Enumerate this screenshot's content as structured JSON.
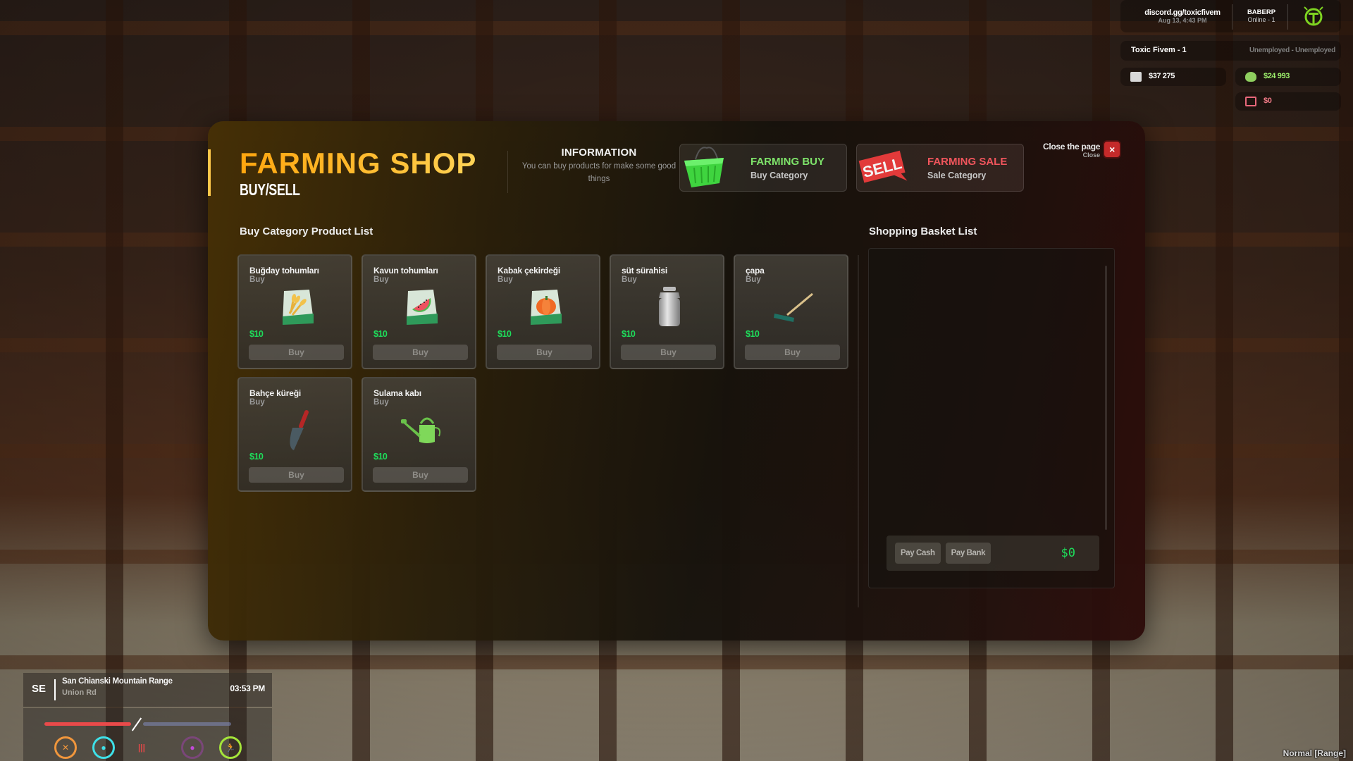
{
  "shop": {
    "title": "FARMING SHOP",
    "subtitle": "BUY/SELL",
    "info": {
      "title": "INFORMATION",
      "text": "You can buy products for make some good things"
    },
    "categories": [
      {
        "title": "FARMING BUY",
        "subtitle": "Buy Category",
        "icon": "basket-icon",
        "color": "#7ee36a"
      },
      {
        "title": "FARMING SALE",
        "subtitle": "Sale Category",
        "icon": "sell-tag-icon",
        "color": "#f0555c"
      }
    ],
    "close": {
      "title": "Close the page",
      "subtitle": "Close",
      "icon": "×"
    },
    "product_list_title": "Buy Category Product List",
    "basket_title": "Shopping Basket List",
    "products": [
      {
        "name": "Buğday tohumları",
        "action": "Buy",
        "price": "$10",
        "button": "Buy",
        "icon": "wheat-seed-bag-icon"
      },
      {
        "name": "Kavun tohumları",
        "action": "Buy",
        "price": "$10",
        "button": "Buy",
        "icon": "melon-seed-bag-icon"
      },
      {
        "name": "Kabak çekirdeği",
        "action": "Buy",
        "price": "$10",
        "button": "Buy",
        "icon": "pumpkin-seed-bag-icon"
      },
      {
        "name": "süt sürahisi",
        "action": "Buy",
        "price": "$10",
        "button": "Buy",
        "icon": "milk-can-icon"
      },
      {
        "name": "çapa",
        "action": "Buy",
        "price": "$10",
        "button": "Buy",
        "icon": "rake-icon"
      },
      {
        "name": "Bahçe küreği",
        "action": "Buy",
        "price": "$10",
        "button": "Buy",
        "icon": "trowel-icon"
      },
      {
        "name": "Sulama kabı",
        "action": "Buy",
        "price": "$10",
        "button": "Buy",
        "icon": "watering-can-icon"
      }
    ],
    "basket": {
      "items": [],
      "pay_cash": "Pay Cash",
      "pay_bank": "Pay Bank",
      "total": "$0"
    }
  },
  "hud": {
    "discord": "discord.gg/toxicfivem",
    "datetime": "Aug 13, 4:43 PM",
    "server": "BABERP",
    "online": "Online - 1",
    "player": "Toxic Fivem - 1",
    "job": "Unemployed - Unemployed",
    "bank": "$37 275",
    "cash": "$24 993",
    "dirty": "$0",
    "direction": "SE",
    "zone": "San Chianski Mountain Range",
    "street": "Union Rd",
    "time": "03:53 PM",
    "health": 0.98,
    "armor": 0,
    "voice": "Normal [Range]"
  },
  "colors": {
    "accent": "#ffb01f",
    "price_green": "#1edc5a",
    "buy_green": "#7ee36a",
    "sale_red": "#f0555c",
    "close_red": "#c42a2a"
  }
}
